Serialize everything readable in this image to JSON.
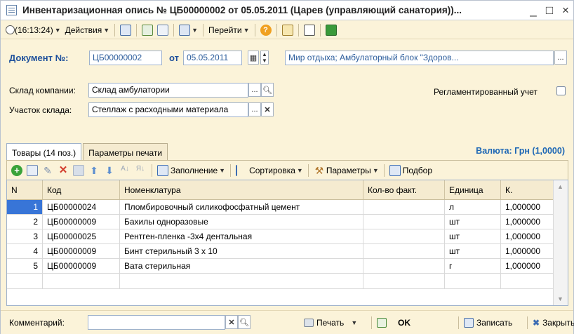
{
  "window": {
    "title": "Инвентаризационная опись № ЦБ00000002 от 05.05.2011 (Царев (управляющий санатория))...",
    "minimize_glyph": "_",
    "maximize_glyph": "□",
    "close_glyph": "×"
  },
  "toolbar": {
    "time": "(16:13:24)",
    "actions_label": "Действия",
    "goto_label": "Перейти"
  },
  "doc": {
    "number_label": "Документ №:",
    "number_value": "ЦБ00000002",
    "date_label": "от",
    "date_value": "05.05.2011",
    "org_value": "Мир отдыха; Амбулаторный блок \"Здоров..."
  },
  "warehouse": {
    "label": "Склад компании:",
    "value": "Склад амбулатории",
    "section_label": "Участок склада:",
    "section_value": "Стеллаж с расходными материала",
    "regulated_label": "Регламентированный учет"
  },
  "tabs": [
    {
      "label": "Товары (14 поз.)",
      "active": true
    },
    {
      "label": "Параметры печати",
      "active": false
    }
  ],
  "currency_label": "Валюта: Грн (1,0000)",
  "table_toolbar": {
    "fill_label": "Заполнение",
    "sort_label": "Сортировка",
    "params_label": "Параметры",
    "pick_label": "Подбор"
  },
  "table": {
    "columns": [
      "N",
      "Код",
      "Номенклатура",
      "Кол-во факт.",
      "Единица",
      "К."
    ],
    "rows": [
      {
        "n": "1",
        "code": "ЦБ00000024",
        "name": "Пломбировочный силикофосфатный цемент",
        "qty": "",
        "unit": "л",
        "k": "1,000000",
        "selected": true
      },
      {
        "n": "2",
        "code": "ЦБ00000009",
        "name": "Бахилы одноразовые",
        "qty": "",
        "unit": "шт",
        "k": "1,000000"
      },
      {
        "n": "3",
        "code": "ЦБ00000025",
        "name": "Рентген-пленка -3х4 дентальная",
        "qty": "",
        "unit": "шт",
        "k": "1,000000"
      },
      {
        "n": "4",
        "code": "ЦБ00000009",
        "name": "Бинт стерильный 3 х 10",
        "qty": "",
        "unit": "шт",
        "k": "1,000000"
      },
      {
        "n": "5",
        "code": "ЦБ00000009",
        "name": "Вата стерильная",
        "qty": "",
        "unit": "г",
        "k": "1,000000"
      }
    ]
  },
  "bottom": {
    "comment_label": "Комментарий:",
    "print_label": "Печать",
    "ok_label": "OK",
    "save_label": "Записать",
    "close_label": "Закрыть"
  },
  "colors": {
    "accent_blue": "#1d4f9b",
    "currency_blue": "#1d67b5",
    "selection": "#3875d7",
    "background": "#fbf3d9"
  }
}
